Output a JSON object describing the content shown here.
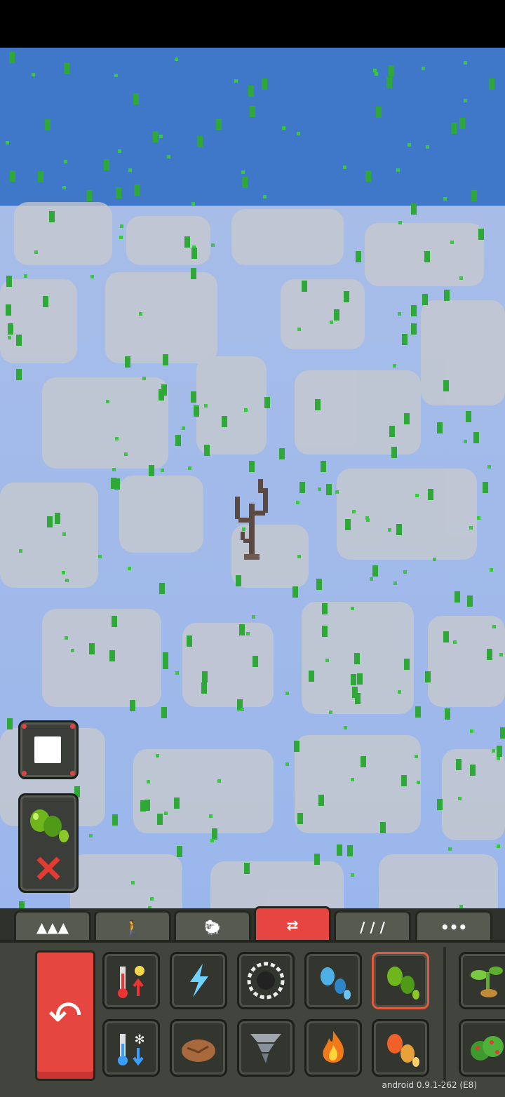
{
  "tabs": [
    {
      "name": "terrain",
      "icon": "mountains-icon",
      "glyph": "▲▲▲"
    },
    {
      "name": "creatures",
      "icon": "person-icon",
      "glyph": "🚶"
    },
    {
      "name": "animals",
      "icon": "animal-icon",
      "glyph": "🐑"
    },
    {
      "name": "nature",
      "icon": "nature-powers-icon",
      "glyph": "⇄"
    },
    {
      "name": "tools",
      "icon": "bombs-icon",
      "glyph": "/ / /"
    },
    {
      "name": "more",
      "icon": "more-icon",
      "glyph": "•••"
    }
  ],
  "active_tab": "nature",
  "toolbar": {
    "undo_icon": "undo-icon",
    "row1": [
      "heat-sun-icon",
      "lightning-icon",
      "black-hole-icon",
      "rain-drops-icon",
      "acid-seeds-icon",
      "plant-sprout-icon"
    ],
    "row2": [
      "cold-snowflake-icon",
      "fertile-soil-icon",
      "tornado-icon",
      "fire-icon",
      "lava-drops-icon",
      "bush-icon"
    ],
    "selected": "acid-seeds-icon"
  },
  "version": "android 0.9.1-262 (E8)",
  "colors": {
    "accent": "#e64541",
    "seed_green": "#2ea836",
    "water_deep": "#3f78c8",
    "water_shallow": "#a7bde8",
    "cloud": "#c6c8cc"
  }
}
